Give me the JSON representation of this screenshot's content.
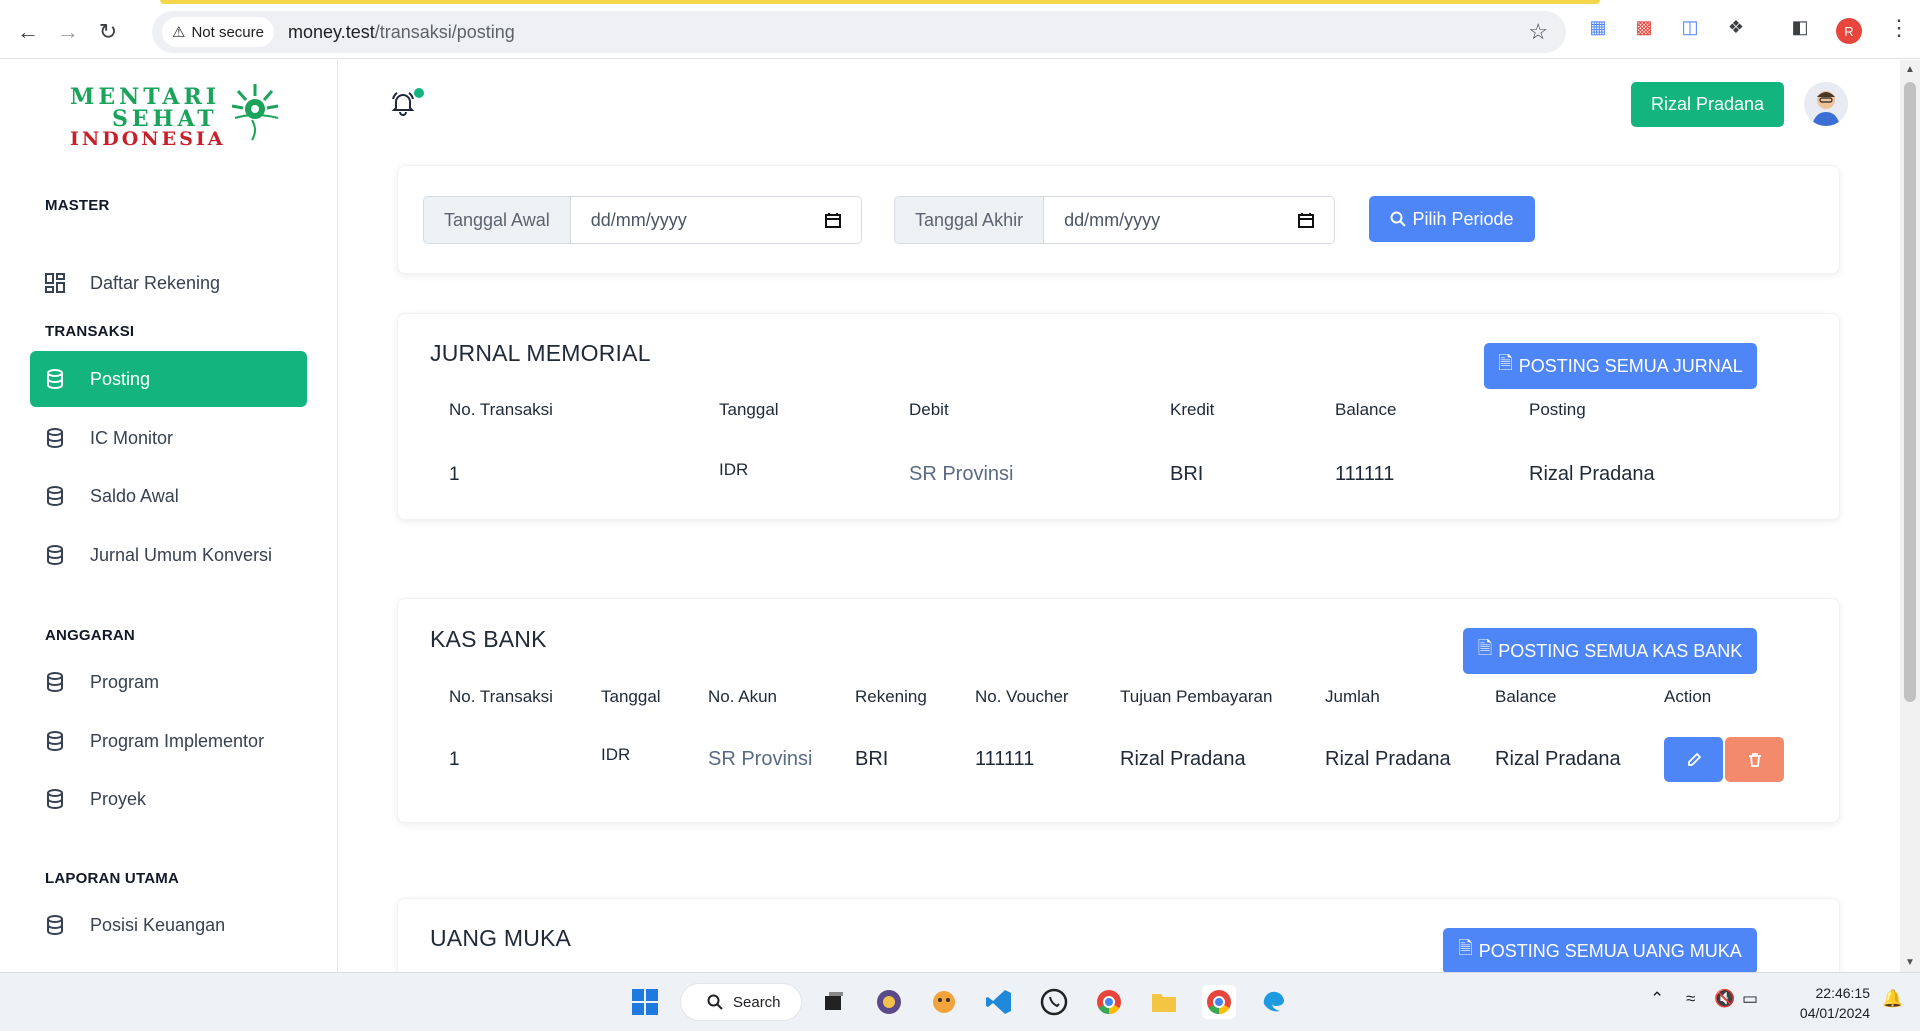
{
  "browser": {
    "not_secure": "Not secure",
    "url_host": "money.test",
    "url_path": "/transaksi/posting",
    "profile_initial": "R"
  },
  "logo": {
    "line1": "MENTARI",
    "line2": "SEHAT",
    "line3": "INDONESIA"
  },
  "sidebar": {
    "sections": [
      {
        "title": "MASTER",
        "items": [
          {
            "label": "Daftar Rekening",
            "icon": "grid-icon"
          }
        ]
      },
      {
        "title": "TRANSAKSI",
        "items": [
          {
            "label": "Posting",
            "icon": "database-icon",
            "active": true
          },
          {
            "label": "IC Monitor",
            "icon": "database-icon"
          },
          {
            "label": "Saldo Awal",
            "icon": "database-icon"
          },
          {
            "label": "Jurnal Umum Konversi",
            "icon": "database-icon"
          }
        ]
      },
      {
        "title": "ANGGARAN",
        "items": [
          {
            "label": "Program",
            "icon": "database-icon"
          },
          {
            "label": "Program Implementor",
            "icon": "database-icon"
          },
          {
            "label": "Proyek",
            "icon": "database-icon"
          }
        ]
      },
      {
        "title": "LAPORAN UTAMA",
        "items": [
          {
            "label": "Posisi Keuangan",
            "icon": "database-icon"
          }
        ]
      }
    ]
  },
  "header": {
    "user_name": "Rizal Pradana"
  },
  "period": {
    "start_label": "Tanggal Awal",
    "start_placeholder": "dd/mm/yyyy",
    "end_label": "Tanggal Akhir",
    "end_placeholder": "dd/mm/yyyy",
    "button": "Pilih Periode"
  },
  "jurnal": {
    "title": "JURNAL MEMORIAL",
    "button": "POSTING SEMUA JURNAL",
    "columns": [
      "No. Transaksi",
      "Tanggal",
      "Debit",
      "Kredit",
      "Balance",
      "Posting"
    ],
    "rows": [
      [
        "1",
        "IDR",
        "SR Provinsi",
        "BRI",
        "111111",
        "Rizal Pradana"
      ]
    ]
  },
  "kasbank": {
    "title": "KAS BANK",
    "button": "POSTING SEMUA KAS BANK",
    "columns": [
      "No. Transaksi",
      "Tanggal",
      "No. Akun",
      "Rekening",
      "No. Voucher",
      "Tujuan Pembayaran",
      "Jumlah",
      "Balance",
      "Action"
    ],
    "rows": [
      [
        "1",
        "IDR",
        "SR Provinsi",
        "BRI",
        "111111",
        "Rizal Pradana",
        "Rizal Pradana",
        "Rizal Pradana"
      ]
    ]
  },
  "uangmuka": {
    "title": "UANG MUKA",
    "button": "POSTING SEMUA UANG MUKA"
  },
  "taskbar": {
    "search": "Search",
    "time": "22:46:15",
    "date": "04/01/2024"
  },
  "colors": {
    "primary_green": "#14b47e",
    "primary_blue": "#4f86f7",
    "danger": "#f38a6c"
  }
}
